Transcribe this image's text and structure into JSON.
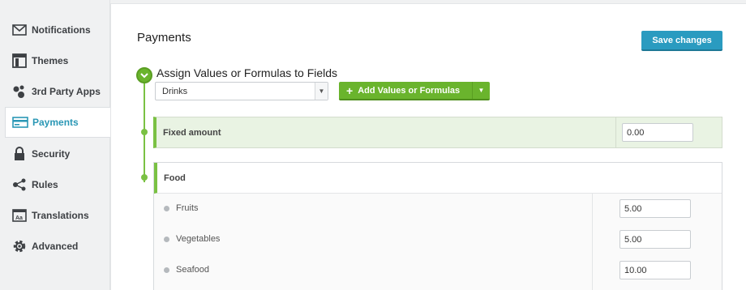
{
  "sidebar": {
    "items": [
      {
        "label": "Notifications",
        "icon": "envelope-icon"
      },
      {
        "label": "Themes",
        "icon": "theme-icon"
      },
      {
        "label": "3rd Party Apps",
        "icon": "apps-icon"
      },
      {
        "label": "Payments",
        "icon": "payment-card-icon",
        "active": true
      },
      {
        "label": "Security",
        "icon": "lock-icon"
      },
      {
        "label": "Rules",
        "icon": "rules-icon"
      },
      {
        "label": "Translations",
        "icon": "translations-icon"
      },
      {
        "label": "Advanced",
        "icon": "gear-icon"
      }
    ]
  },
  "main": {
    "title": "Payments",
    "save_label": "Save changes",
    "step_title": "Assign Values or Formulas to Fields",
    "select_value": "Drinks",
    "add_label": "Add Values or Formulas",
    "fixed_amount": {
      "label": "Fixed amount",
      "value": "0.00"
    },
    "food": {
      "label": "Food",
      "rows": [
        {
          "name": "Fruits",
          "value": "5.00"
        },
        {
          "name": "Vegetables",
          "value": "5.00"
        },
        {
          "name": "Seafood",
          "value": "10.00"
        }
      ]
    }
  },
  "colors": {
    "accent_blue": "#2a9bc0",
    "accent_green": "#6ab42d",
    "highlight_row": "#e9f3e3"
  }
}
